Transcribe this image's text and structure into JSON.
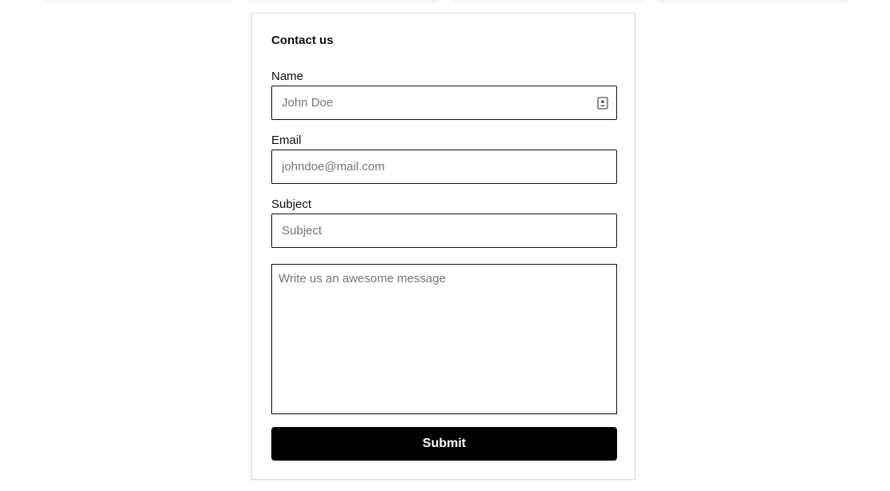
{
  "form": {
    "title": "Contact us",
    "name": {
      "label": "Name",
      "placeholder": "John Doe",
      "value": "",
      "icon": "contact-card-icon"
    },
    "email": {
      "label": "Email",
      "placeholder": "johndoe@mail.com",
      "value": ""
    },
    "subject": {
      "label": "Subject",
      "placeholder": "Subject",
      "value": ""
    },
    "message": {
      "placeholder": "Write us an awesome message",
      "value": ""
    },
    "submit_label": "Submit"
  },
  "colors": {
    "button_bg": "#000000",
    "button_text": "#ffffff",
    "border": "#111111",
    "placeholder": "#767676"
  }
}
